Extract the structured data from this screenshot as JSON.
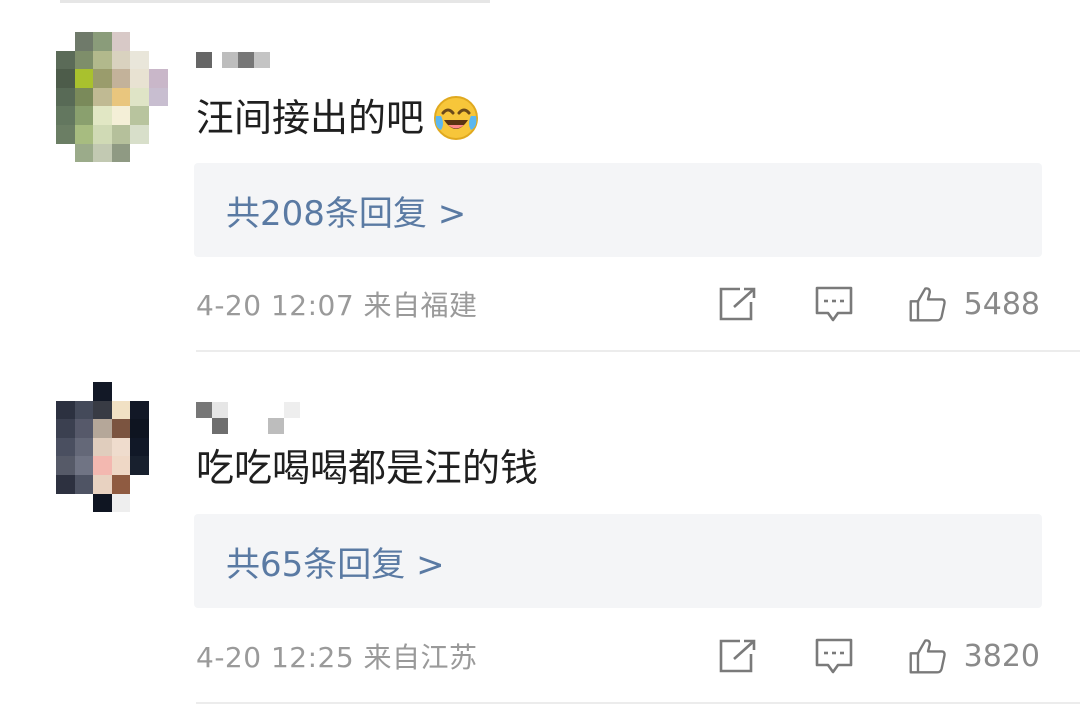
{
  "comments": [
    {
      "text": "汪间接出的吧",
      "emoji": "laughing-crying-emoji",
      "replies_label": "共208条回复 >",
      "timestamp": "4-20 12:07",
      "location": "来自福建",
      "likes": "5488"
    },
    {
      "text": "吃吃喝喝都是汪的钱",
      "replies_label": "共65条回复 >",
      "timestamp": "4-20 12:25",
      "location": "来自江苏",
      "likes": "3820"
    }
  ],
  "icons": [
    "share-icon",
    "comment-icon",
    "like-icon"
  ],
  "colors": {
    "link": "#5a7aa3",
    "meta": "#9a9a9a",
    "reply_bg": "#f4f5f7"
  }
}
